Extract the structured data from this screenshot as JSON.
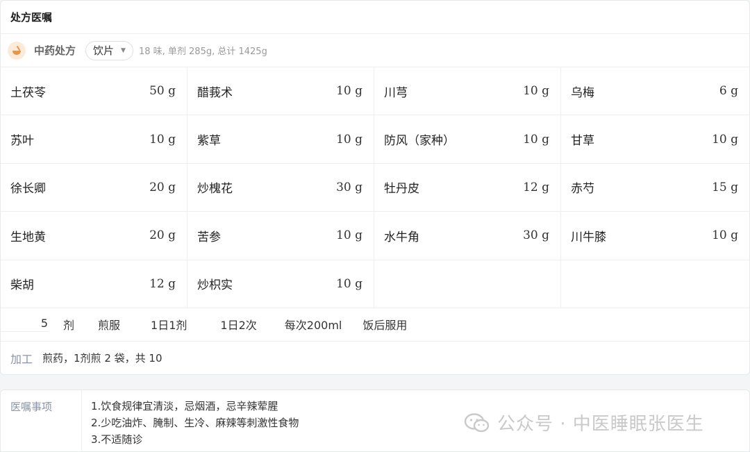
{
  "card": {
    "title": "处方医嘱"
  },
  "rx": {
    "title": "中药处方",
    "type": "饮片",
    "summary": "18 味, 单剂 285g, 总计 1425g"
  },
  "herbs": [
    {
      "name": "土茯苓",
      "dose": "50 g"
    },
    {
      "name": "醋莪术",
      "dose": "10 g"
    },
    {
      "name": "川芎",
      "dose": "10 g"
    },
    {
      "name": "乌梅",
      "dose": "6 g"
    },
    {
      "name": "苏叶",
      "dose": "10 g"
    },
    {
      "name": "紫草",
      "dose": "10 g"
    },
    {
      "name": "防风（家种）",
      "dose": "10 g"
    },
    {
      "name": "甘草",
      "dose": "10 g"
    },
    {
      "name": "徐长卿",
      "dose": "20 g"
    },
    {
      "name": "炒槐花",
      "dose": "30 g"
    },
    {
      "name": "牡丹皮",
      "dose": "12 g"
    },
    {
      "name": "赤芍",
      "dose": "15 g"
    },
    {
      "name": "生地黄",
      "dose": "20 g"
    },
    {
      "name": "苦参",
      "dose": "10 g"
    },
    {
      "name": "水牛角",
      "dose": "30 g"
    },
    {
      "name": "川牛膝",
      "dose": "10 g"
    },
    {
      "name": "柴胡",
      "dose": "12 g"
    },
    {
      "name": "炒枳实",
      "dose": "10 g"
    }
  ],
  "usage": {
    "doses": "5",
    "dose_unit": "剂",
    "method": "煎服",
    "daily_doses": "1日1剂",
    "daily_times": "1日2次",
    "per_time": "每次200ml",
    "timing": "饭后服用"
  },
  "processing": {
    "label": "加工",
    "value": "煎药，1剂煎 2 袋，共 10"
  },
  "advice": {
    "label": "医嘱事项",
    "items": [
      "1.饮食规律宜清淡，忌烟酒，忌辛辣荤腥",
      "2.少吃油炸、腌制、生冷、麻辣等刺激性食物",
      "3.不适随诊"
    ]
  },
  "watermark": {
    "text": "公众号 · 中医睡眠张医生"
  },
  "colors": {
    "accent_orange": "#e8944a",
    "label_gray": "#8a93a6"
  },
  "icons": {
    "rx": "mortar-bowl-icon",
    "watermark": "wechat-icon"
  }
}
